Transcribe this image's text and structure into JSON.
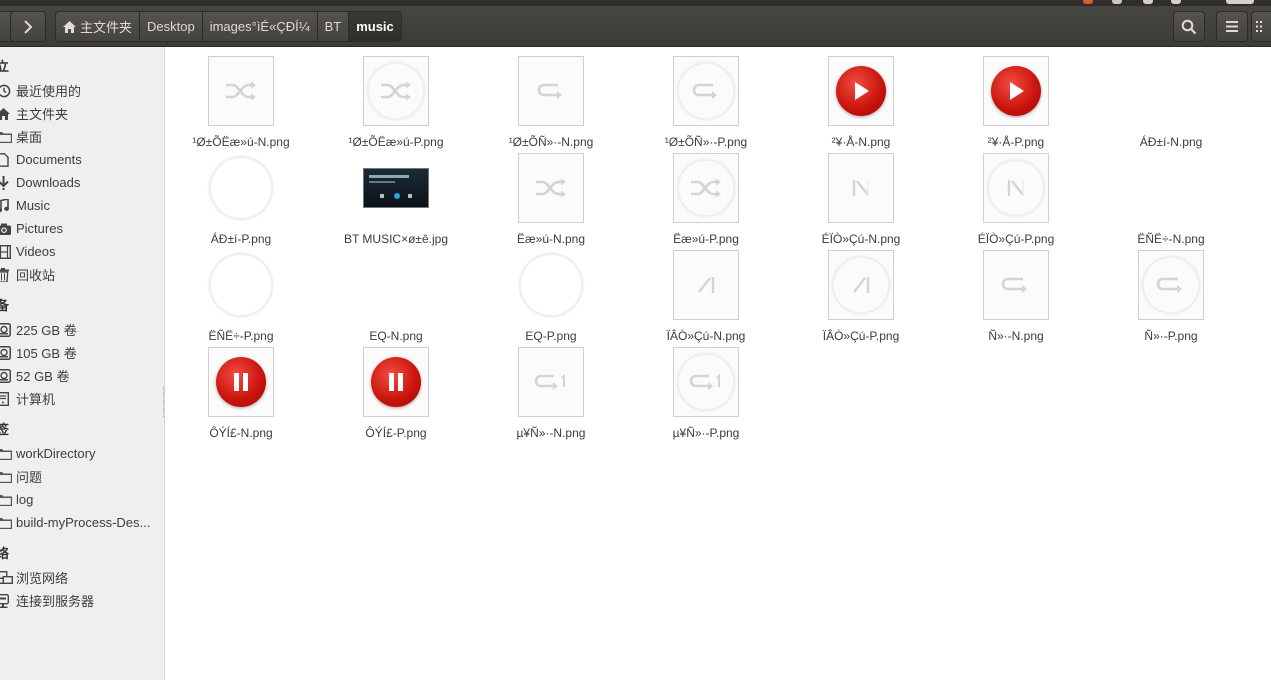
{
  "toolbar": {
    "back_icon": "back-arrow-icon",
    "forward_icon": "forward-arrow-icon",
    "breadcrumbs": [
      {
        "label": "主文件夹",
        "icon": "home-icon"
      },
      {
        "label": "Desktop"
      },
      {
        "label": "images°ìÉ«ÇÐÍ¼"
      },
      {
        "label": "BT"
      },
      {
        "label": "music",
        "active": true
      }
    ],
    "search_icon": "search-icon",
    "menu_icon": "hamburger-menu-icon",
    "view_icon": "grid-view-icon"
  },
  "sidebar": {
    "sections": [
      {
        "title": "位置",
        "shown": "立"
      },
      {
        "title": "设备",
        "shown": "备"
      },
      {
        "title": "书签",
        "shown": "签"
      },
      {
        "title": "网络",
        "shown": "络"
      }
    ],
    "places": [
      {
        "label": "最近使用的",
        "icon": "recent-clock-icon"
      },
      {
        "label": "主文件夹",
        "icon": "home-icon"
      },
      {
        "label": "桌面",
        "icon": "folder-icon"
      },
      {
        "label": "Documents",
        "icon": "document-icon"
      },
      {
        "label": "Downloads",
        "icon": "download-icon"
      },
      {
        "label": "Music",
        "icon": "music-note-icon"
      },
      {
        "label": "Pictures",
        "icon": "camera-icon"
      },
      {
        "label": "Videos",
        "icon": "film-icon"
      },
      {
        "label": "回收站",
        "icon": "trash-icon"
      }
    ],
    "devices": [
      {
        "label": "225 GB 卷",
        "icon": "drive-icon"
      },
      {
        "label": "105 GB 卷",
        "icon": "drive-icon"
      },
      {
        "label": "52 GB 卷",
        "icon": "drive-icon"
      },
      {
        "label": "计算机",
        "icon": "computer-icon"
      }
    ],
    "bookmarks": [
      {
        "label": "workDirectory",
        "icon": "folder-icon"
      },
      {
        "label": "问题",
        "icon": "folder-icon"
      },
      {
        "label": "log",
        "icon": "folder-icon"
      },
      {
        "label": "build-myProcess-Des...",
        "icon": "folder-icon"
      }
    ],
    "network": [
      {
        "label": "浏览网络",
        "icon": "network-icon"
      },
      {
        "label": "连接到服务器",
        "icon": "server-icon"
      }
    ]
  },
  "files": [
    {
      "name": "¹Ø±ÕËæ»ú-N.png",
      "kind": "shuffle"
    },
    {
      "name": "¹Ø±ÕËæ»ú-P.png",
      "kind": "shuffle-ring"
    },
    {
      "name": "¹Ø±ÕÑ»·-N.png",
      "kind": "repeat"
    },
    {
      "name": "¹Ø±ÕÑ»·-P.png",
      "kind": "repeat-ring"
    },
    {
      "name": "²¥·Å-N.png",
      "kind": "play"
    },
    {
      "name": "²¥·Å-P.png",
      "kind": "play"
    },
    {
      "name": "ÁÐ±í-N.png",
      "kind": "blank"
    },
    {
      "name": "ÁÐ±í-P.png",
      "kind": "ring-only"
    },
    {
      "name": "BT MUSIC×ø±ê.jpg",
      "kind": "screenshot"
    },
    {
      "name": "Ëæ»ú-N.png",
      "kind": "shuffle"
    },
    {
      "name": "Ëæ»ú-P.png",
      "kind": "shuffle-ring"
    },
    {
      "name": "ÉÏÒ»Çú-N.png",
      "kind": "prev"
    },
    {
      "name": "ÉÏÒ»Çú-P.png",
      "kind": "prev-ring"
    },
    {
      "name": "ËÑË÷-N.png",
      "kind": "blank"
    },
    {
      "name": "ËÑË÷-P.png",
      "kind": "ring-only"
    },
    {
      "name": "EQ-N.png",
      "kind": "blank"
    },
    {
      "name": "EQ-P.png",
      "kind": "ring-only"
    },
    {
      "name": "ÏÂÒ»Çú-N.png",
      "kind": "next"
    },
    {
      "name": "ÏÂÒ»Çú-P.png",
      "kind": "next-ring"
    },
    {
      "name": "Ñ»·-N.png",
      "kind": "loop"
    },
    {
      "name": "Ñ»·-P.png",
      "kind": "loop-ring"
    },
    {
      "name": "ÔÝÍ£-N.png",
      "kind": "pause"
    },
    {
      "name": "ÔÝÍ£-P.png",
      "kind": "pause"
    },
    {
      "name": "µ¥Ñ»·-N.png",
      "kind": "loop-one"
    },
    {
      "name": "µ¥Ñ»·-P.png",
      "kind": "loop-one-ring"
    }
  ],
  "colors": {
    "toolbar_bg": "#3c3b37",
    "sidebar_bg": "#efefef",
    "play_red": "#d11510",
    "text": "#3c3c3c"
  }
}
